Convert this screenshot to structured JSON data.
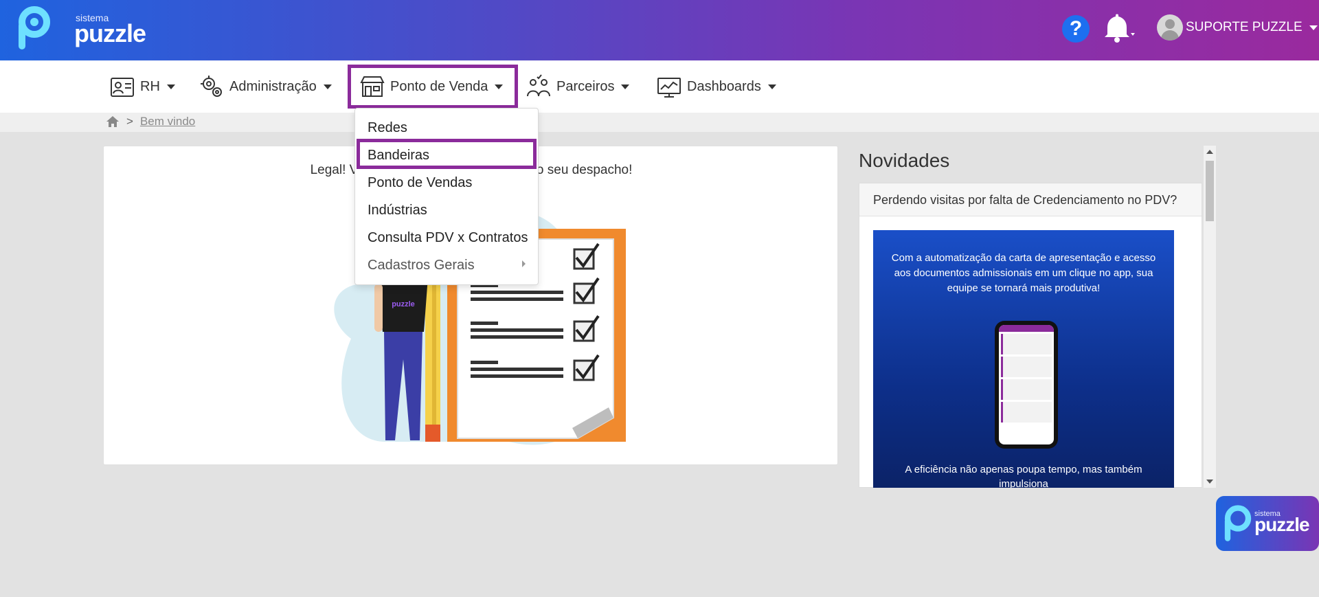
{
  "brand": {
    "small": "sistema",
    "big": "puzzle"
  },
  "header": {
    "help_icon": "question-circle-icon",
    "help_label": "?",
    "bell_icon": "bell-icon",
    "user_name": "SUPORTE PUZZLE",
    "colors": {
      "gradient_start": "#1f63df",
      "gradient_end": "#9a2a9e",
      "accent": "#8b2b9b"
    }
  },
  "menu": {
    "items": [
      {
        "label": "RH",
        "icon": "id-card-icon"
      },
      {
        "label": "Administração",
        "icon": "gears-icon"
      },
      {
        "label": "Ponto de Venda",
        "icon": "store-icon"
      },
      {
        "label": "Parceiros",
        "icon": "partners-icon"
      },
      {
        "label": "Dashboards",
        "icon": "dashboard-monitor-icon"
      }
    ],
    "active": "Ponto de Venda"
  },
  "breadcrumb": {
    "home_icon": "home-icon",
    "separator": ">",
    "current": "Bem vindo"
  },
  "dropdown": {
    "items": [
      {
        "label": "Redes"
      },
      {
        "label": "Bandeiras"
      },
      {
        "label": "Ponto de Vendas"
      },
      {
        "label": "Indústrias"
      },
      {
        "label": "Consulta PDV x Contratos"
      },
      {
        "label": "Cadastros Gerais"
      }
    ],
    "highlighted": "Bandeiras"
  },
  "main": {
    "message_left": "Legal! Você nã",
    "message_right": "rdando seu despacho!"
  },
  "novidades": {
    "title": "Novidades",
    "card_title": "Perdendo visitas por falta de Credenciamento no PDV?",
    "promo_top": "Com a automatização da carta de apresentação e acesso aos documentos admissionais em um clique no app, sua equipe se tornará mais produtiva!",
    "promo_bottom": "A eficiência não apenas poupa tempo, mas também impulsiona"
  },
  "float_badge": {
    "small": "sistema",
    "big": "puzzle"
  }
}
